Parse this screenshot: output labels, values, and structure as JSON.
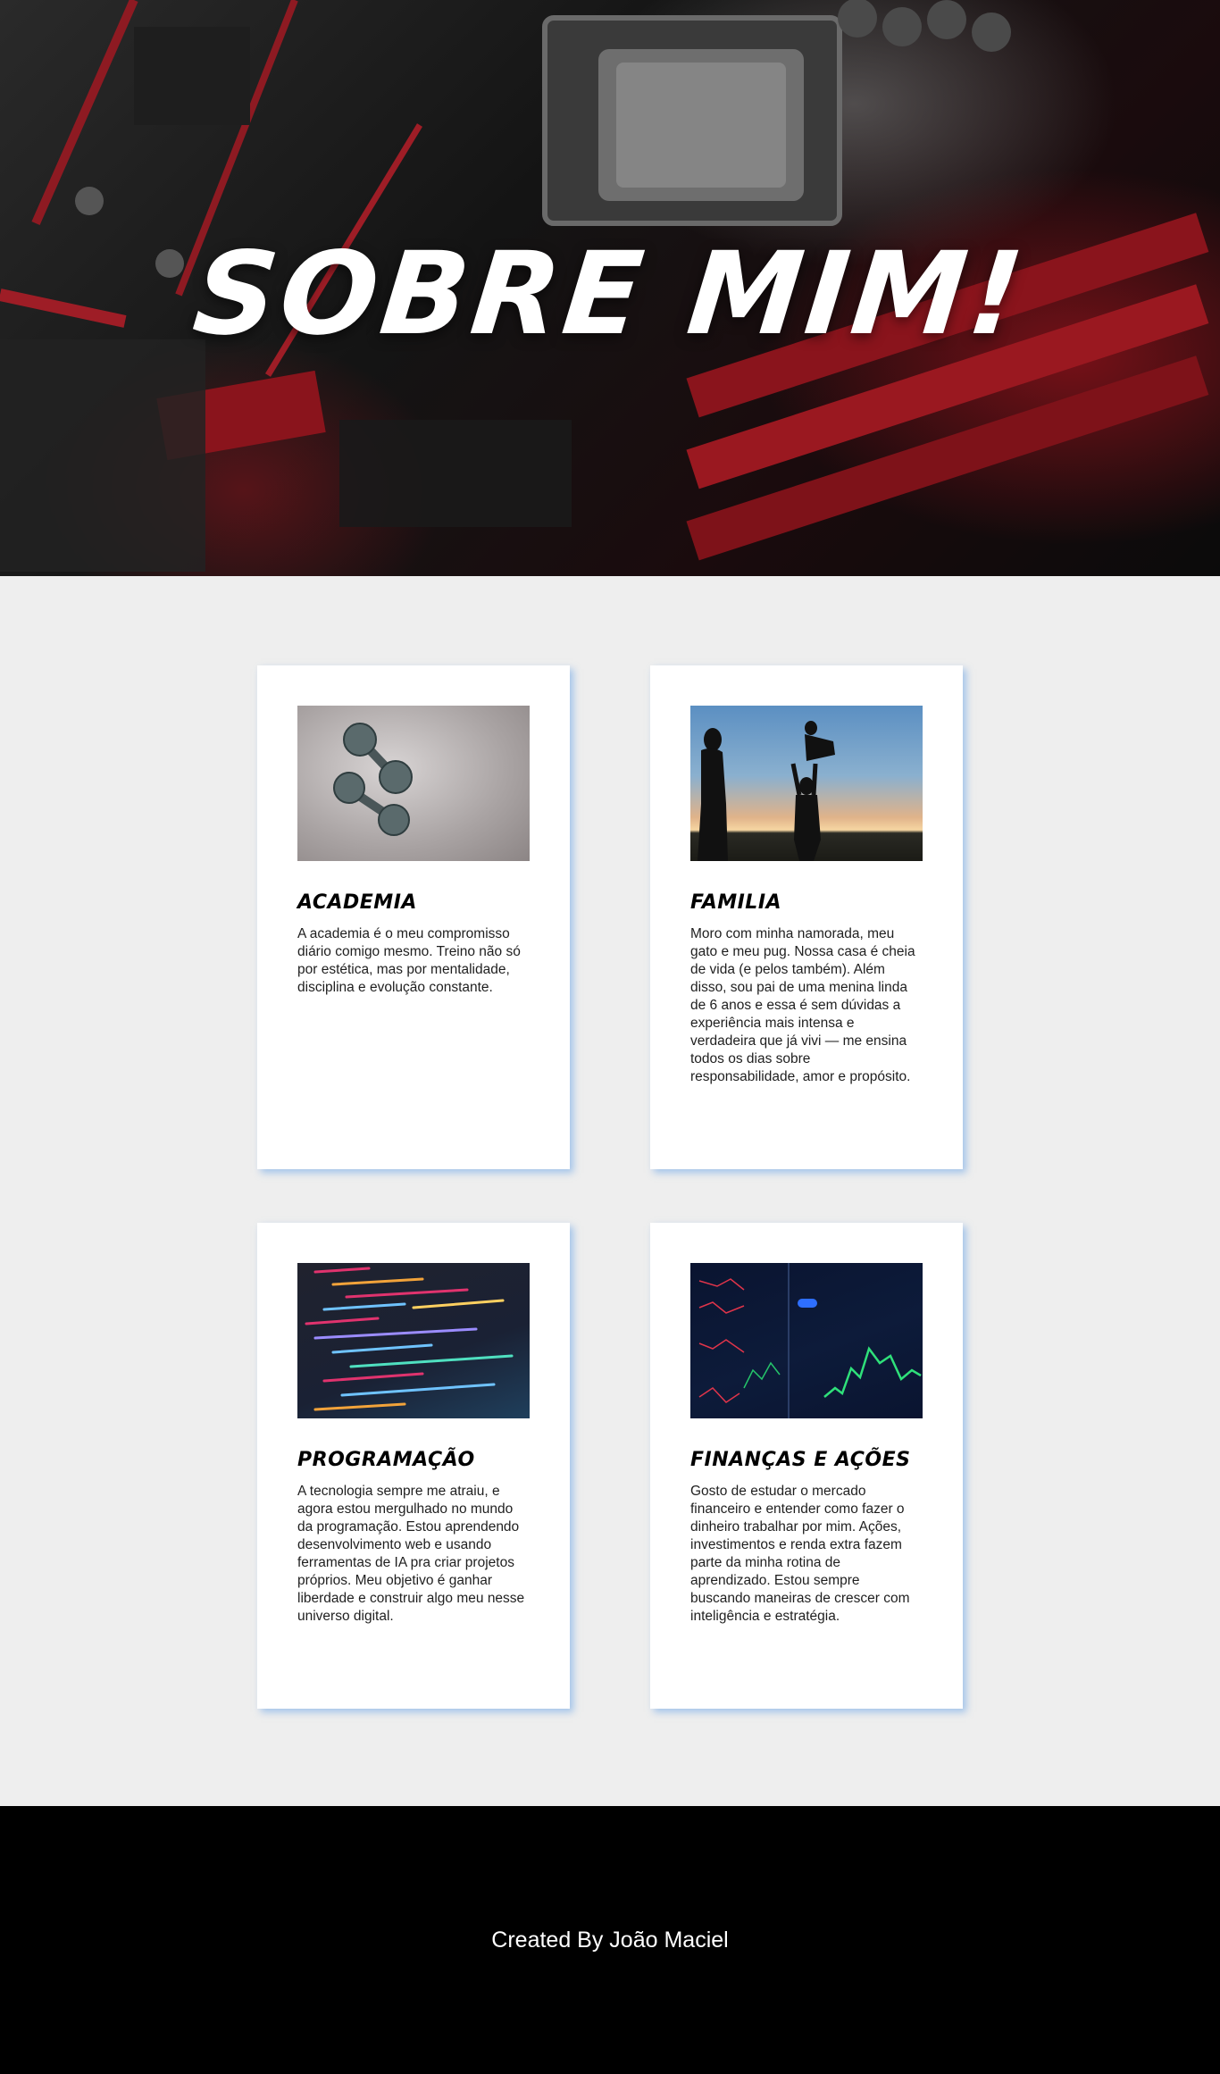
{
  "hero": {
    "title": "SOBRE MIM!"
  },
  "cards": [
    {
      "title": "ACADEMIA",
      "text": "A academia é o meu compromisso diário comigo mesmo. Treino não só por estética, mas por mentalidade, disciplina e evolução constante."
    },
    {
      "title": "FAMILIA",
      "text": "Moro com minha namorada, meu gato e meu pug. Nossa casa é cheia de vida (e pelos também). Além disso, sou pai de uma menina linda de 6 anos e essa é sem dúvidas a experiência mais intensa e verdadeira que já vivi — me ensina todos os dias sobre responsabilidade, amor e propósito."
    },
    {
      "title": "PROGRAMAÇÃO",
      "text": "A tecnologia sempre me atraiu, e agora estou mergulhado no mundo da programação. Estou aprendendo desenvolvimento web e usando ferramentas de IA pra criar projetos próprios. Meu objetivo é ganhar liberdade e construir algo meu nesse universo digital."
    },
    {
      "title": "FINANÇAS E AÇÕES",
      "text": "Gosto de estudar o mercado financeiro e entender como fazer o dinheiro trabalhar por mim. Ações, investimentos e renda extra fazem parte da minha rotina de aprendizado. Estou sempre buscando maneiras de crescer com inteligência e estratégia."
    }
  ],
  "footer": {
    "credit": "Created By João Maciel"
  },
  "colors": {
    "page_background": "#eeeeee",
    "card_shadow": "#64a0e6",
    "footer_background": "#000000"
  }
}
